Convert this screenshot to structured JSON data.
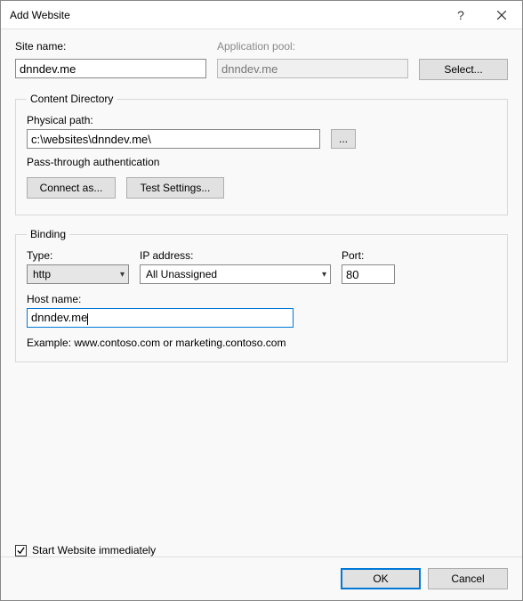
{
  "title": "Add Website",
  "site_name_label": "Site name:",
  "site_name_value": "dnndev.me",
  "app_pool_label": "Application pool:",
  "app_pool_value": "dnndev.me",
  "select_button": "Select...",
  "content_directory": {
    "legend": "Content Directory",
    "physical_path_label": "Physical path:",
    "physical_path_value": "c:\\websites\\dnndev.me\\",
    "browse_button": "...",
    "passthrough_label": "Pass-through authentication",
    "connect_as_button": "Connect as...",
    "test_settings_button": "Test Settings..."
  },
  "binding": {
    "legend": "Binding",
    "type_label": "Type:",
    "type_value": "http",
    "ip_label": "IP address:",
    "ip_value": "All Unassigned",
    "port_label": "Port:",
    "port_value": "80",
    "host_label": "Host name:",
    "host_value": "dnndev.me",
    "example_text": "Example: www.contoso.com or marketing.contoso.com"
  },
  "start_immediately_label": "Start Website immediately",
  "start_immediately_checked": true,
  "ok_button": "OK",
  "cancel_button": "Cancel"
}
